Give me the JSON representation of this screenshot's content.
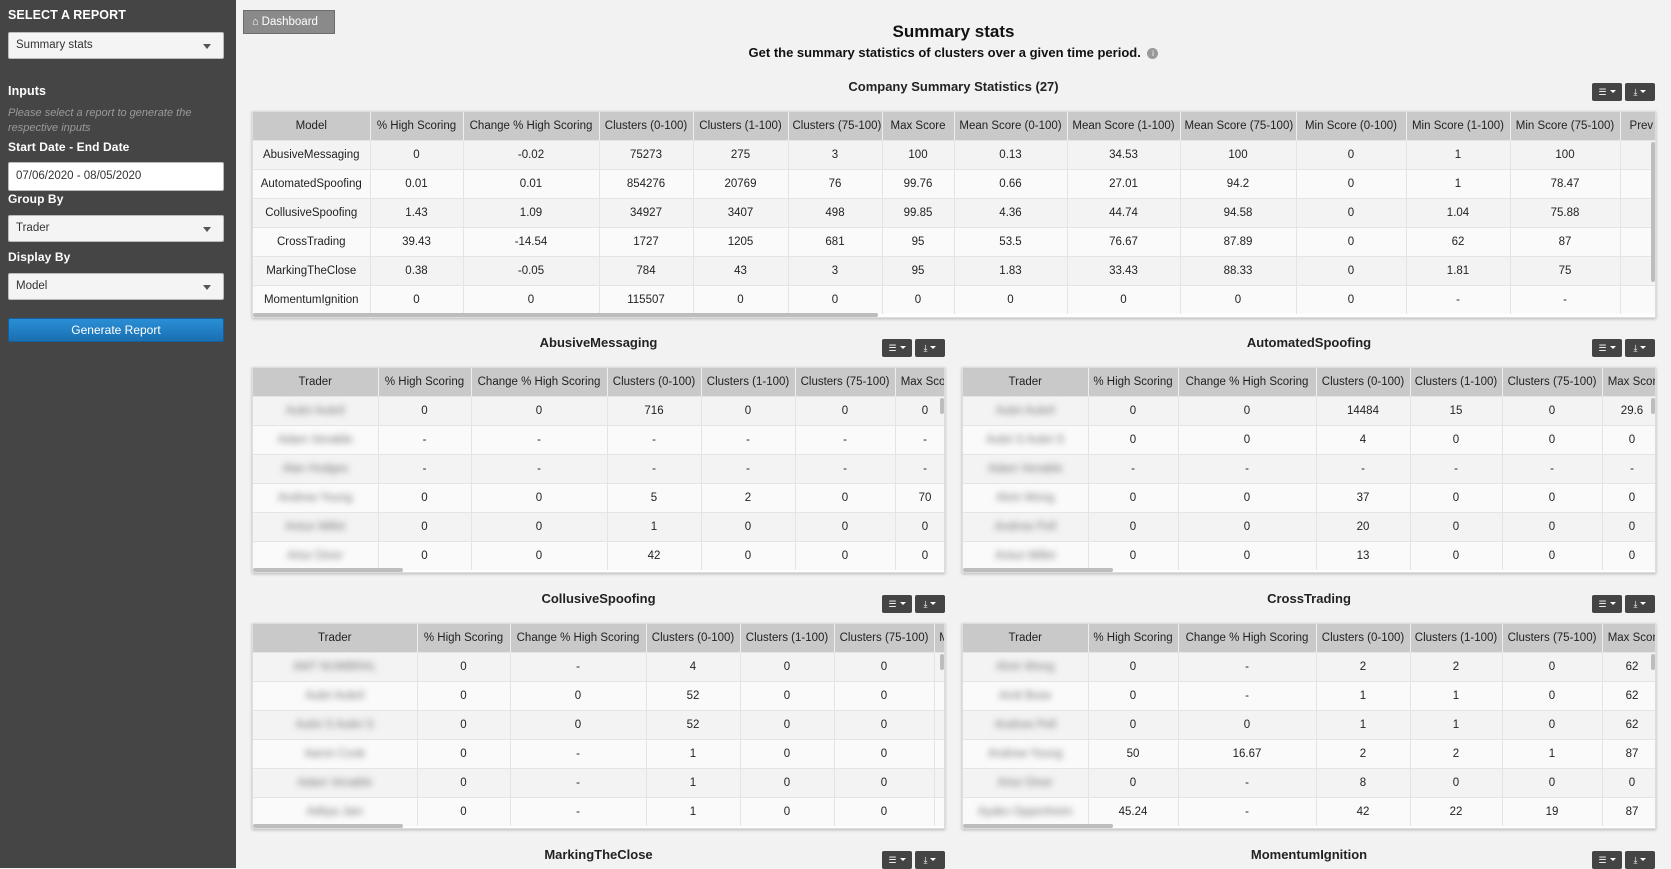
{
  "sidebar": {
    "select_report_label": "SELECT A REPORT",
    "report_value": "Summary stats",
    "inputs_label": "Inputs",
    "hint": "Please select a report to generate the respective inputs",
    "date_label": "Start Date - End Date",
    "date_value": "07/06/2020 - 08/05/2020",
    "group_by_label": "Group By",
    "group_by_value": "Trader",
    "display_by_label": "Display By",
    "display_by_value": "Model",
    "generate_label": "Generate Report"
  },
  "header": {
    "dashboard_label": "Dashboard",
    "title": "Summary stats",
    "subtitle": "Get the summary statistics of clusters over a given time period."
  },
  "company": {
    "title": "Company Summary Statistics (27)",
    "columns": [
      "Model",
      "% High Scoring",
      "Change % High Scoring",
      "Clusters (0-100)",
      "Clusters (1-100)",
      "Clusters (75-100)",
      "Max Score",
      "Mean Score (0-100)",
      "Mean Score (1-100)",
      "Mean Score (75-100)",
      "Min Score (0-100)",
      "Min Score (1-100)",
      "Min Score (75-100)",
      "Prev Pe"
    ],
    "rows": [
      [
        "AbusiveMessaging",
        "0",
        "-0.02",
        "75273",
        "275",
        "3",
        "100",
        "0.13",
        "34.53",
        "100",
        "0",
        "1",
        "100",
        ""
      ],
      [
        "AutomatedSpoofing",
        "0.01",
        "0.01",
        "854276",
        "20769",
        "76",
        "99.76",
        "0.66",
        "27.01",
        "94.2",
        "0",
        "1",
        "78.47",
        ""
      ],
      [
        "CollusiveSpoofing",
        "1.43",
        "1.09",
        "34927",
        "3407",
        "498",
        "99.85",
        "4.36",
        "44.74",
        "94.58",
        "0",
        "1.04",
        "75.88",
        ""
      ],
      [
        "CrossTrading",
        "39.43",
        "-14.54",
        "1727",
        "1205",
        "681",
        "95",
        "53.5",
        "76.67",
        "87.89",
        "0",
        "62",
        "87",
        ""
      ],
      [
        "MarkingTheClose",
        "0.38",
        "-0.05",
        "784",
        "43",
        "3",
        "95",
        "1.83",
        "33.43",
        "88.33",
        "0",
        "1.81",
        "75",
        ""
      ],
      [
        "MomentumIgnition",
        "0",
        "0",
        "115507",
        "0",
        "0",
        "0",
        "0",
        "0",
        "0",
        "0",
        "-",
        "-",
        ""
      ]
    ]
  },
  "panels": [
    {
      "title": "AbusiveMessaging",
      "columns": [
        "Trader",
        "% High Scoring",
        "Change % High Scoring",
        "Clusters (0-100)",
        "Clusters (1-100)",
        "Clusters (75-100)",
        "Max Scor"
      ],
      "rows": [
        [
          "Aubri Aubril",
          "0",
          "0",
          "716",
          "0",
          "0",
          "0"
        ],
        [
          "Adam Venable",
          "-",
          "-",
          "-",
          "-",
          "-",
          "-"
        ],
        [
          "Alan Hodges",
          "-",
          "-",
          "-",
          "-",
          "-",
          "-"
        ],
        [
          "Andrew Young",
          "0",
          "0",
          "5",
          "2",
          "0",
          "70"
        ],
        [
          "Antun Millet",
          "0",
          "0",
          "1",
          "0",
          "0",
          "0"
        ],
        [
          "Artur Diner",
          "0",
          "0",
          "42",
          "0",
          "0",
          "0"
        ]
      ]
    },
    {
      "title": "AutomatedSpoofing",
      "columns": [
        "Trader",
        "% High Scoring",
        "Change % High Scoring",
        "Clusters (0-100)",
        "Clusters (1-100)",
        "Clusters (75-100)",
        "Max Scor"
      ],
      "rows": [
        [
          "Aubri Aubril",
          "0",
          "0",
          "14484",
          "15",
          "0",
          "29.6"
        ],
        [
          "Aubri S Aubri S",
          "0",
          "0",
          "4",
          "0",
          "0",
          "0"
        ],
        [
          "Adam Venable",
          "-",
          "-",
          "-",
          "-",
          "-",
          "-"
        ],
        [
          "Alvin Wong",
          "0",
          "0",
          "37",
          "0",
          "0",
          "0"
        ],
        [
          "Andrew Pell",
          "0",
          "0",
          "20",
          "0",
          "0",
          "0"
        ],
        [
          "Antun Millet",
          "0",
          "0",
          "13",
          "0",
          "0",
          "0"
        ]
      ]
    },
    {
      "title": "CollusiveSpoofing",
      "columns": [
        "Trader",
        "% High Scoring",
        "Change % High Scoring",
        "Clusters (0-100)",
        "Clusters (1-100)",
        "Clusters (75-100)",
        "M"
      ],
      "rows": [
        [
          "AMT NUMBRAL",
          "0",
          "-",
          "4",
          "0",
          "0",
          ""
        ],
        [
          "Aubri Aubril",
          "0",
          "0",
          "52",
          "0",
          "0",
          ""
        ],
        [
          "Aubri S Aubri S",
          "0",
          "0",
          "52",
          "0",
          "0",
          ""
        ],
        [
          "Aaron Cook",
          "0",
          "-",
          "1",
          "0",
          "0",
          ""
        ],
        [
          "Adam Venable",
          "0",
          "-",
          "1",
          "0",
          "0",
          ""
        ],
        [
          "Aditya Jain",
          "0",
          "-",
          "1",
          "0",
          "0",
          ""
        ]
      ]
    },
    {
      "title": "CrossTrading",
      "columns": [
        "Trader",
        "% High Scoring",
        "Change % High Scoring",
        "Clusters (0-100)",
        "Clusters (1-100)",
        "Clusters (75-100)",
        "Max Scor"
      ],
      "rows": [
        [
          "Alvin Wong",
          "0",
          "-",
          "2",
          "2",
          "0",
          "62"
        ],
        [
          "Amit Bose",
          "0",
          "-",
          "1",
          "1",
          "0",
          "62"
        ],
        [
          "Andrew Pell",
          "0",
          "0",
          "1",
          "1",
          "0",
          "62"
        ],
        [
          "Andrew Young",
          "50",
          "16.67",
          "2",
          "2",
          "1",
          "87"
        ],
        [
          "Artur Diner",
          "0",
          "-",
          "8",
          "0",
          "0",
          "0"
        ],
        [
          "Ayako Oppenheim",
          "45.24",
          "-",
          "42",
          "22",
          "19",
          "87"
        ]
      ]
    },
    {
      "title": "MarkingTheClose"
    },
    {
      "title": "MomentumIgnition"
    }
  ],
  "toolbar": {
    "columns_icon": "columns-icon",
    "download_icon": "download-icon"
  }
}
